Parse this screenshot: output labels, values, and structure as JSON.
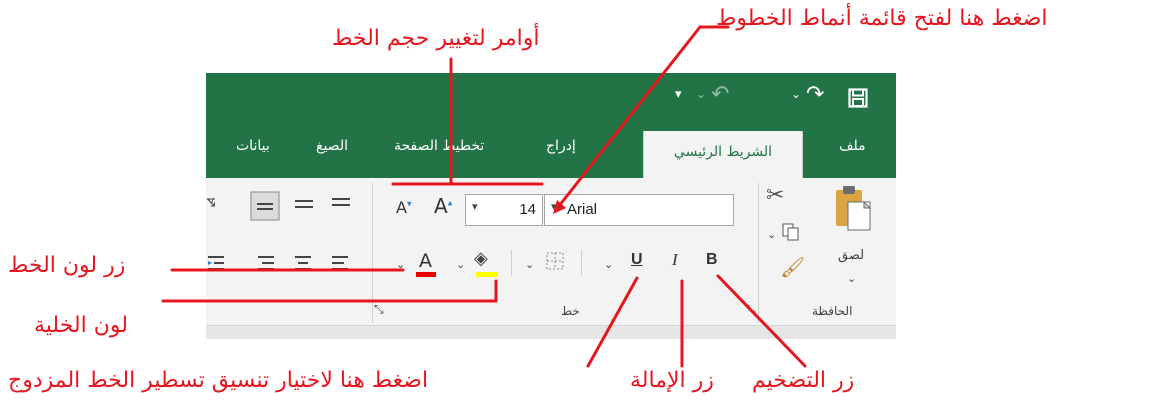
{
  "annotations": {
    "font_style_menu": "اضغط هنا لفتح قائمة أنماط الخطوط",
    "font_size_commands": "أوامر لتغيير حجم الخط",
    "font_color_button": "زر لون الخط",
    "cell_color": "لون الخلية",
    "double_underline": "اضغط هنا لاختيار تنسيق تسطير الخط المزدوج",
    "italic_button": "زر الإمالة",
    "bold_button": "زر التضخيم"
  },
  "tabs": {
    "file": "ملف",
    "home": "الشريط الرئيسي",
    "insert": "إدراج",
    "page_layout": "تخطيط الصفحة",
    "formulas": "الصيغ",
    "data": "بيانات"
  },
  "font": {
    "name": "Arial",
    "size": "14"
  },
  "groups": {
    "clipboard": "الحافظة",
    "font": "خط",
    "paste": "لصق"
  },
  "colors": {
    "excel_green": "#227447",
    "annotation_red": "#e6161e",
    "font_color_bar": "#e60000",
    "fill_color_bar": "#ffff00"
  }
}
